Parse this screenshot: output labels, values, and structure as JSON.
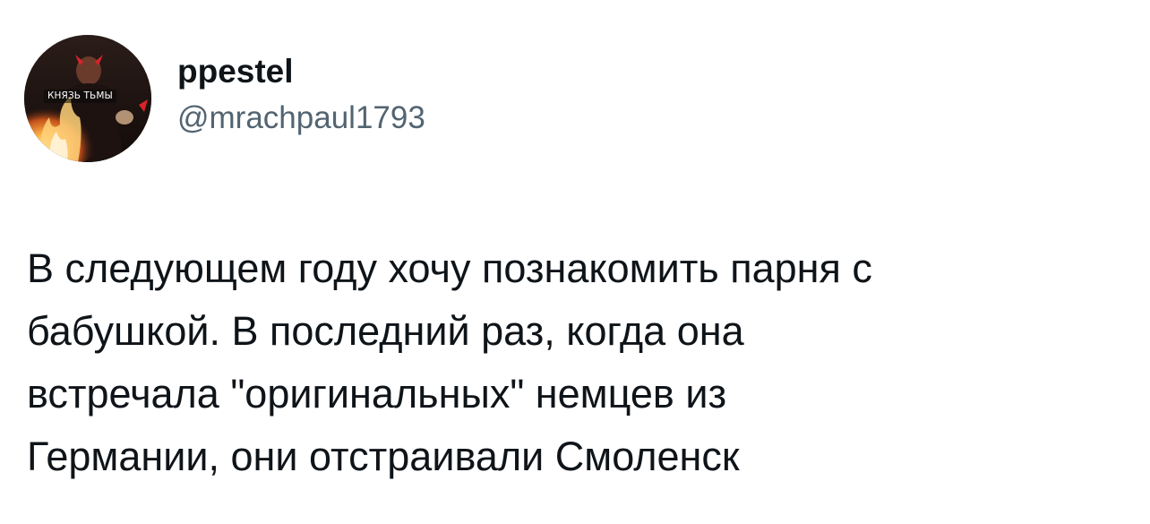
{
  "author": {
    "display_name": "ppestel",
    "handle": "@mrachpaul1793",
    "avatar": {
      "icon": "avatar-photo",
      "caption": "КНЯЗЬ ТЬМЫ"
    }
  },
  "tweet": {
    "lines": [
      "В следующем году хочу познакомить парня с",
      "бабушкой. В последний раз, когда она",
      "встречала \"оригинальных\" немцев из",
      "Германии, они отстраивали Смоленск"
    ]
  },
  "colors": {
    "text_primary": "#0f1419",
    "text_secondary": "#536471",
    "background": "#ffffff"
  }
}
